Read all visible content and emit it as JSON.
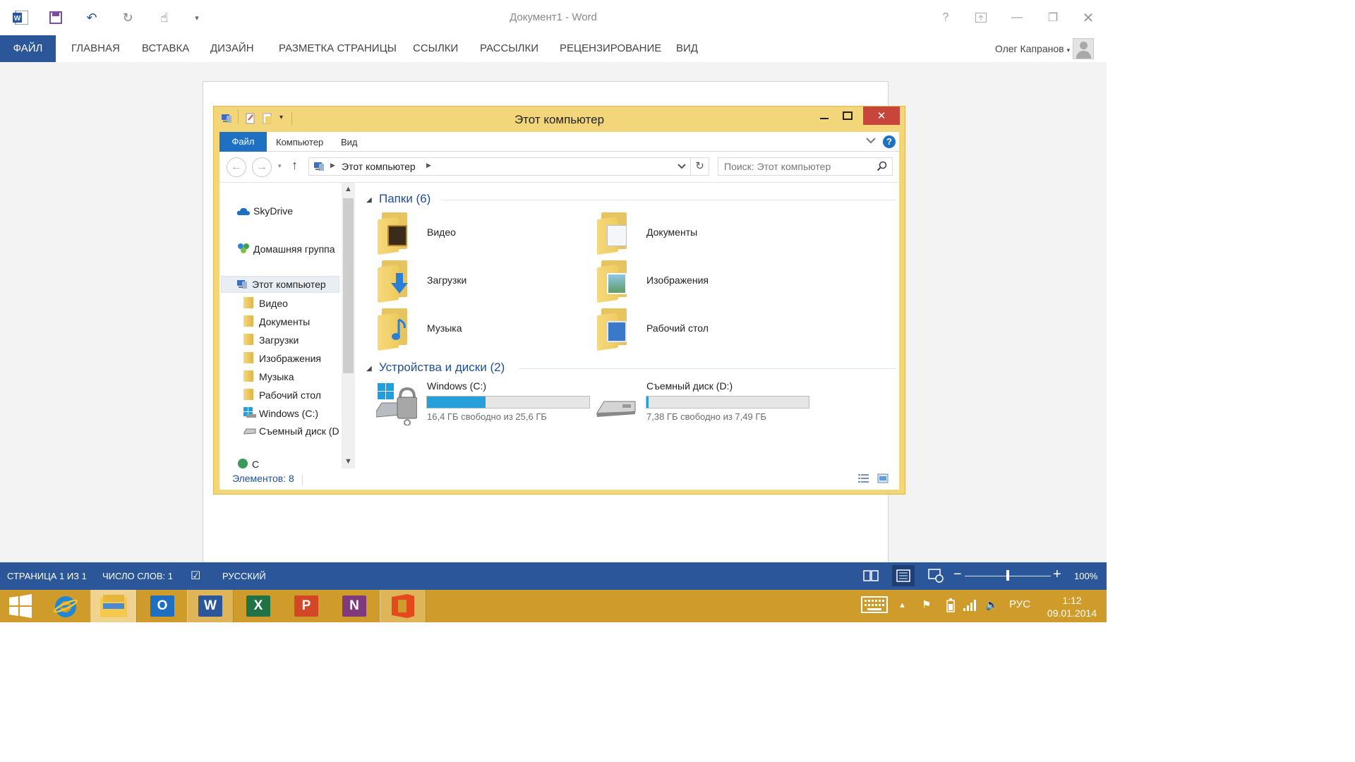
{
  "word": {
    "doc_title": "Документ1 - Word",
    "tabs": [
      {
        "label": "ФАЙЛ"
      },
      {
        "label": "ГЛАВНАЯ"
      },
      {
        "label": "ВСТАВКА"
      },
      {
        "label": "ДИЗАЙН"
      },
      {
        "label": "РАЗМЕТКА СТРАНИЦЫ"
      },
      {
        "label": "ССЫЛКИ"
      },
      {
        "label": "РАССЫЛКИ"
      },
      {
        "label": "РЕЦЕНЗИРОВАНИЕ"
      },
      {
        "label": "ВИД"
      }
    ],
    "user_name": "Олег Капранов",
    "help_glyph": "?",
    "status": {
      "page": "СТРАНИЦА 1 ИЗ 1",
      "words": "ЧИСЛО СЛОВ: 1",
      "language": "РУССКИЙ",
      "zoom": "100%"
    },
    "accent_color": "#2b579a"
  },
  "explorer": {
    "title": "Этот компьютер",
    "ribbon_tabs": [
      {
        "label": "Файл"
      },
      {
        "label": "Компьютер"
      },
      {
        "label": "Вид"
      }
    ],
    "help_glyph": "?",
    "address": "Этот компьютер",
    "search_placeholder": "Поиск: Этот компьютер",
    "nav": {
      "favorites": [
        {
          "label": "SkyDrive",
          "icon": "cloud-icon"
        },
        {
          "label": "Домашняя группа",
          "icon": "homegroup-icon"
        }
      ],
      "this_pc": "Этот компьютер",
      "children": [
        {
          "label": "Видео"
        },
        {
          "label": "Документы"
        },
        {
          "label": "Загрузки"
        },
        {
          "label": "Изображения"
        },
        {
          "label": "Музыка"
        },
        {
          "label": "Рабочий стол"
        },
        {
          "label": "Windows (C:)"
        },
        {
          "label": "Съемный диск (D"
        }
      ],
      "partial_item": "С"
    },
    "folders_header": "Папки (6)",
    "folders": [
      {
        "label": "Видео",
        "icon": "video-folder-icon"
      },
      {
        "label": "Документы",
        "icon": "documents-folder-icon"
      },
      {
        "label": "Загрузки",
        "icon": "downloads-folder-icon"
      },
      {
        "label": "Изображения",
        "icon": "pictures-folder-icon"
      },
      {
        "label": "Музыка",
        "icon": "music-folder-icon"
      },
      {
        "label": "Рабочий стол",
        "icon": "desktop-folder-icon"
      }
    ],
    "drives_header": "Устройства и диски (2)",
    "drives": [
      {
        "label": "Windows (C:)",
        "free": "16,4 ГБ свободно из 25,6 ГБ",
        "used_fraction": 0.36
      },
      {
        "label": "Съемный диск (D:)",
        "free": "7,38 ГБ свободно из 7,49 ГБ",
        "used_fraction": 0.015
      }
    ],
    "status": "Элементов: 8",
    "frame_color": "#f3d57a"
  },
  "taskbar": {
    "apps": [
      {
        "name": "internet-explorer",
        "letter": "e",
        "color": "#1e88d6"
      },
      {
        "name": "file-explorer",
        "letter": "",
        "color": "#f5c94e"
      },
      {
        "name": "outlook",
        "letter": "O",
        "color": "#1f6fc0"
      },
      {
        "name": "word",
        "letter": "W",
        "color": "#2b579a"
      },
      {
        "name": "excel",
        "letter": "X",
        "color": "#217346"
      },
      {
        "name": "powerpoint",
        "letter": "P",
        "color": "#d24726"
      },
      {
        "name": "onenote",
        "letter": "N",
        "color": "#80397b"
      },
      {
        "name": "office",
        "letter": "",
        "color": "#e3491c"
      }
    ],
    "language": "РУС",
    "time": "1:12",
    "date": "09.01.2014",
    "color": "#cf9b2b"
  }
}
